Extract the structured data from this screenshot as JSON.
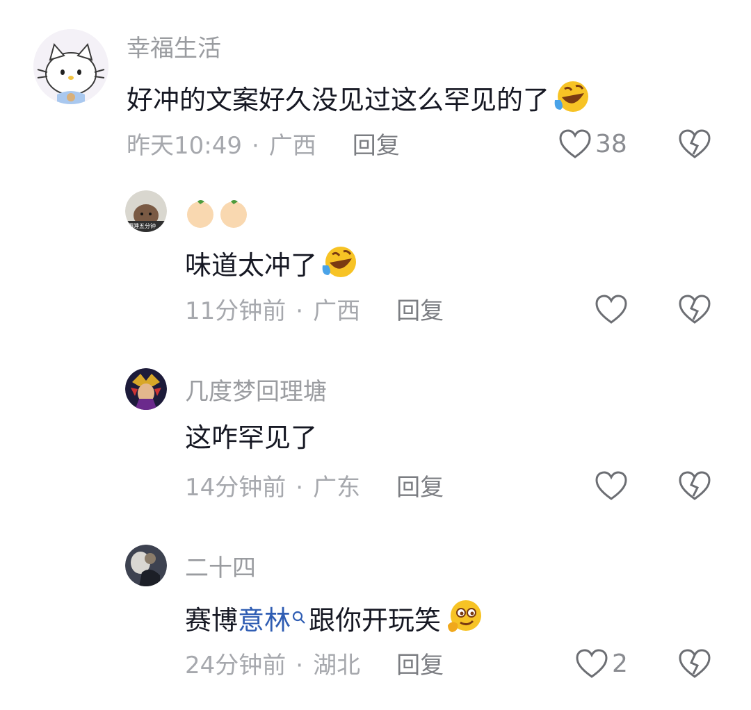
{
  "comments": [
    {
      "user": "幸福生活",
      "text": "好冲的文案好久没见过这么罕见的了",
      "time": "昨天10:49",
      "location": "广西",
      "reply_label": "回复",
      "likes": "38"
    },
    {
      "user": "",
      "avatar_text": "再睡五分钟",
      "text": "味道太冲了",
      "time": "11分钟前",
      "location": "广西",
      "reply_label": "回复",
      "likes": ""
    },
    {
      "user": "几度梦回理塘",
      "text": "这咋罕见了",
      "time": "14分钟前",
      "location": "广东",
      "reply_label": "回复",
      "likes": ""
    },
    {
      "user": "二十四",
      "text_prefix": "赛博",
      "text_link": "意林",
      "text_suffix": "跟你开玩笑",
      "time": "24分钟前",
      "location": "湖北",
      "reply_label": "回复",
      "likes": "2"
    }
  ],
  "separator": "·",
  "icons": {
    "like": "heart-outline-icon",
    "dislike": "broken-heart-icon",
    "laugh_emoji": "rofl-emoji",
    "orange_emoji": "orange-fruit-emoji",
    "smirk_emoji": "thinking-smirk-emoji",
    "search_mark": "search-icon"
  },
  "colors": {
    "text": "#161823",
    "muted": "#a6a8ad",
    "link": "#2f5db3"
  }
}
